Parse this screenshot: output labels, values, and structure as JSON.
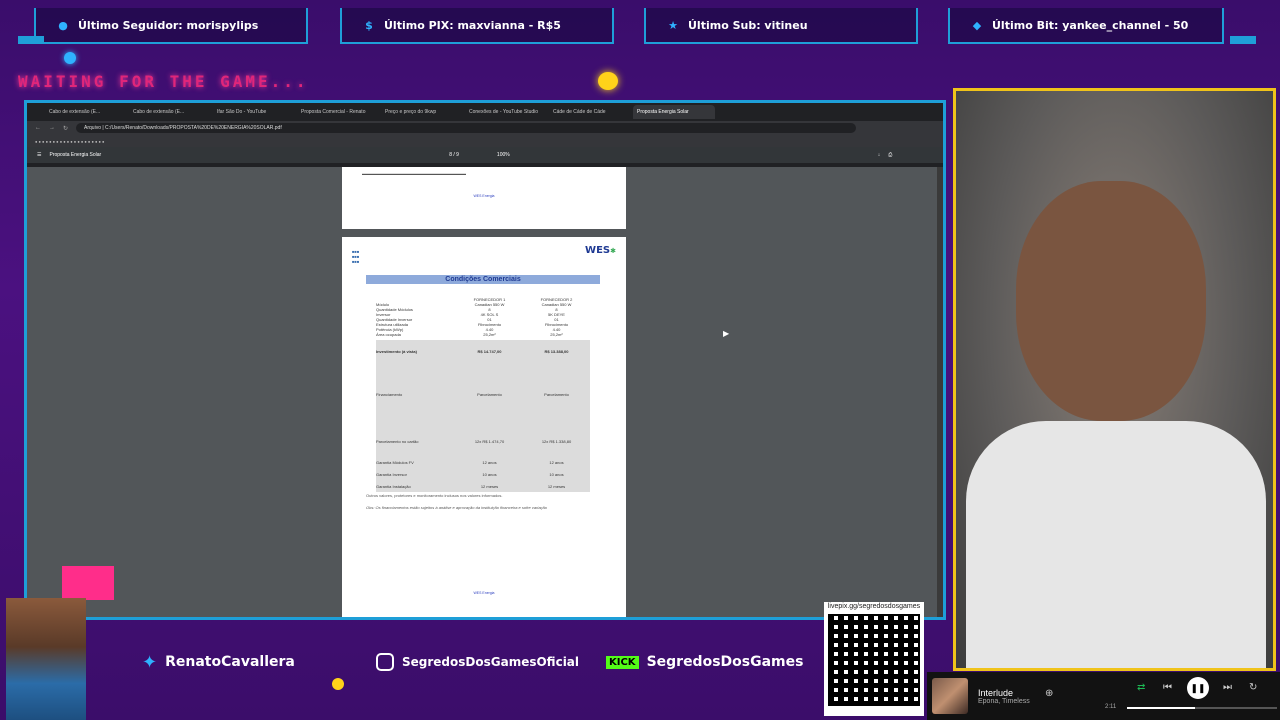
{
  "top_stats": [
    {
      "label": "Último Seguidor: morispylips",
      "icon": "user-icon"
    },
    {
      "label": "Último PIX: maxvianna - R$5",
      "icon": "dollar-icon"
    },
    {
      "label": "Último Sub: vitineu",
      "icon": "star-icon"
    },
    {
      "label": "Último Bit: yankee_channel - 50",
      "icon": "diamond-icon"
    }
  ],
  "waiting_text": "WAITING FOR THE GAME...",
  "browser": {
    "tabs": [
      "Cabo de extensão (E...",
      "Cabo de extensão (E...",
      "Ifar São Do - YouTube",
      "Proposta Comercial - Renato",
      "Preço e preço do 9kwp",
      "Conexões de - YouTube Studio",
      "Cáde de Cáde de Cáde",
      "Proposta Energia Solar"
    ],
    "address": "Arquivo | C:/Users/Renato/Downloads/PROPOSTA%20DE%20ENERGIA%20SOLAR.pdf",
    "pdf_title": "Proposta Energia Solar",
    "pdf_page": "8 / 9",
    "pdf_zoom": "100%"
  },
  "pdf": {
    "page1_footer": "WES Energia",
    "title": "Condições Comerciais",
    "header_cols": [
      "",
      "FORNECEDOR 1",
      "FORNECEDOR 2"
    ],
    "rows": [
      {
        "label": "Módulo",
        "a": "Canadian 550 W",
        "b": "Canadian 550 W"
      },
      {
        "label": "Quantidade Módulos",
        "a": "8",
        "b": "8"
      },
      {
        "label": "Inversor",
        "a": "4K SOL S",
        "b": "5K DEYE"
      },
      {
        "label": "Quantidade Inversor",
        "a": "01",
        "b": "01"
      },
      {
        "label": "Estrutura utilizada",
        "a": "Fibrocimento",
        "b": "Fibrocimento"
      },
      {
        "label": "Potência (kWp)",
        "a": "4.40",
        "b": "4.40"
      },
      {
        "label": "Área ocupada",
        "a": "25,2m²",
        "b": "25,2m²"
      }
    ],
    "grey_rows": [
      {
        "label": "Investimento (à vista)",
        "a": "R$ 14.747,00",
        "b": "R$ 13.388,00"
      },
      {
        "label": "Financiamento",
        "a": "Parcelamento",
        "b": "Parcelamento"
      },
      {
        "label": "Parcelamento no cartão",
        "a": "12x R$ 1.474,70",
        "b": "12x R$ 1.338,80"
      },
      {
        "label": "Garantia Módulos FV",
        "a": "12 anos",
        "b": "12 anos"
      },
      {
        "label": "Garantia Inversor",
        "a": "10 anos",
        "b": "10 anos"
      },
      {
        "label": "Garantia Instalação",
        "a": "12 meses",
        "b": "12 meses"
      }
    ],
    "note1": "Outros valores, protetores e monitoramento inclusos nos valores informados.",
    "note2": "Obs: Os financiamentos estão sujeitos à análise e aprovação da instituição financeira e sofre variação",
    "page2_footer": "WES Energia"
  },
  "socials": [
    {
      "label": "RenatoCavallera",
      "icon": "twitter-icon"
    },
    {
      "label": "SegredosDosGamesOficial",
      "icon": "instagram-icon"
    },
    {
      "label": "SegredosDosGames",
      "icon": "kick-icon",
      "badge": "KICK"
    }
  ],
  "qr_label": "livepix.gg/segredosdosgames",
  "player": {
    "title": "Interlude",
    "artist": "Epona, Timeless",
    "elapsed": "2:11",
    "progress_fraction": 0.45
  },
  "colors": {
    "accent": "#1f9fd8",
    "brand": "#4b1180",
    "cam_border": "#f0c31a",
    "waiting": "#e0267a"
  }
}
